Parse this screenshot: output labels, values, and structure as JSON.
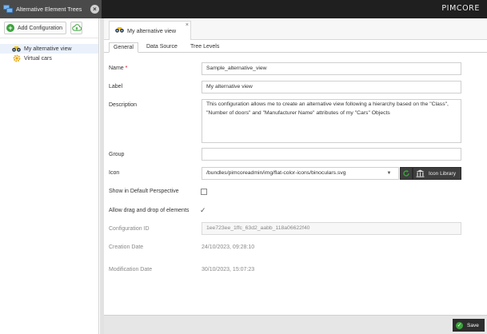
{
  "topbar": {
    "tab_title": "Alternative Element Trees",
    "brand": "PIMCORE"
  },
  "sidebar": {
    "add_label": "Add Configuration",
    "items": [
      {
        "label": "My alternative view",
        "icon": "binoculars-icon",
        "selected": true
      },
      {
        "label": "Virtual cars",
        "icon": "gear-icon",
        "selected": false
      }
    ]
  },
  "main": {
    "view_tab": "My alternative view",
    "close_glyph": "×",
    "subtabs": [
      "General",
      "Data Source",
      "Tree Levels"
    ],
    "form": {
      "name_label": "Name",
      "name_required": "*",
      "name_value": "Sample_alternative_view",
      "label_label": "Label",
      "label_value": "My alternative view",
      "description_label": "Description",
      "description_value": "This configuration allows me to create an alternative view following a hierarchy based on the \"Class\", \"Number of doors\" and \"Manufacturer Name\" attributes of my \"Cars\" Objects",
      "group_label": "Group",
      "group_value": "",
      "icon_label": "Icon",
      "icon_value": "/bundles/pimcoreadmin/img/flat-color-icons/binoculars.svg",
      "icon_library_label": "Icon Library",
      "show_default_label": "Show in Default Perspective",
      "show_default_checked": false,
      "allow_dnd_label": "Allow drag and drop of elements",
      "allow_dnd_checked": true,
      "config_id_label": "Configuration ID",
      "config_id_value": "1ee723ee_1ffc_63d2_aabb_118a06622f40",
      "creation_label": "Creation Date",
      "creation_value": "24/10/2023, 09:28:10",
      "modification_label": "Modification Date",
      "modification_value": "30/10/2023, 15:07:23"
    },
    "save_label": "Save"
  },
  "colors": {
    "topbar": "#1f1f1f",
    "accent_green": "#3aa33a",
    "button_dark": "#3e3e3e"
  }
}
